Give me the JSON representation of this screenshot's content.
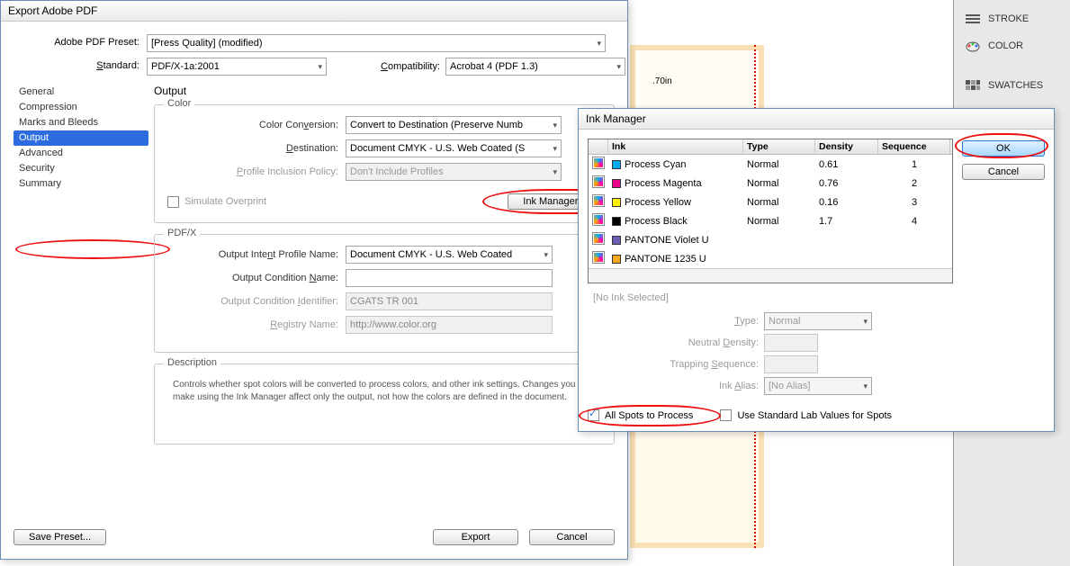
{
  "canvas": {
    "dim": ".70in"
  },
  "side_panel": [
    {
      "label": "STROKE"
    },
    {
      "label": "COLOR"
    },
    {
      "label": "SWATCHES"
    }
  ],
  "export": {
    "title": "Export Adobe PDF",
    "labels": {
      "preset": "Adobe PDF Preset:",
      "standard": "Standard:",
      "compatibility": "Compatibility:"
    },
    "preset": "[Press Quality] (modified)",
    "standard": "PDF/X-1a:2001",
    "compatibility": "Acrobat 4 (PDF 1.3)",
    "tabs": [
      "General",
      "Compression",
      "Marks and Bleeds",
      "Output",
      "Advanced",
      "Security",
      "Summary"
    ],
    "section": "Output",
    "color": {
      "legend": "Color",
      "conv_lbl": "Color Conversion:",
      "conv": "Convert to Destination (Preserve Numb",
      "dest_lbl": "Destination:",
      "dest": "Document CMYK - U.S. Web Coated (S",
      "prof_lbl": "Profile Inclusion Policy:",
      "prof": "Don't Include Profiles",
      "simulate": "Simulate Overprint",
      "ink_btn": "Ink Manager..."
    },
    "pdfx": {
      "legend": "PDF/X",
      "intent_lbl": "Output Intent Profile Name:",
      "intent": "Document CMYK - U.S. Web Coated",
      "cond_lbl": "Output Condition Name:",
      "cond": "",
      "ident_lbl": "Output Condition Identifier:",
      "ident": "CGATS TR 001",
      "reg_lbl": "Registry Name:",
      "reg": "http://www.color.org"
    },
    "desc": {
      "legend": "Description",
      "text": "Controls whether spot colors will be converted to process colors, and other ink settings. Changes you make using the Ink Manager affect only the output, not how the colors are defined in the document."
    },
    "buttons": {
      "save": "Save Preset...",
      "export": "Export",
      "cancel": "Cancel"
    }
  },
  "ink": {
    "title": "Ink Manager",
    "headers": [
      "",
      "Ink",
      "Type",
      "Density",
      "Sequence"
    ],
    "rows": [
      {
        "color": "#00AEEF",
        "name": "Process Cyan",
        "type": "Normal",
        "density": "0.61",
        "seq": "1"
      },
      {
        "color": "#EC008C",
        "name": "Process Magenta",
        "type": "Normal",
        "density": "0.76",
        "seq": "2"
      },
      {
        "color": "#FFF200",
        "name": "Process Yellow",
        "type": "Normal",
        "density": "0.16",
        "seq": "3"
      },
      {
        "color": "#000000",
        "name": "Process Black",
        "type": "Normal",
        "density": "1.7",
        "seq": "4"
      },
      {
        "color": "#6b5fb5",
        "name": "PANTONE Violet U",
        "type": "",
        "density": "",
        "seq": ""
      },
      {
        "color": "#f5a623",
        "name": "PANTONE 1235 U",
        "type": "",
        "density": "",
        "seq": ""
      }
    ],
    "no_sel": "[No Ink Selected]",
    "form": {
      "type_lbl": "Type:",
      "type": "Normal",
      "dens_lbl": "Neutral Density:",
      "seq_lbl": "Trapping Sequence:",
      "alias_lbl": "Ink Alias:",
      "alias": "[No Alias]"
    },
    "checks": {
      "all_spots": "All Spots to Process",
      "lab": "Use Standard Lab Values for Spots"
    },
    "buttons": {
      "ok": "OK",
      "cancel": "Cancel"
    }
  }
}
